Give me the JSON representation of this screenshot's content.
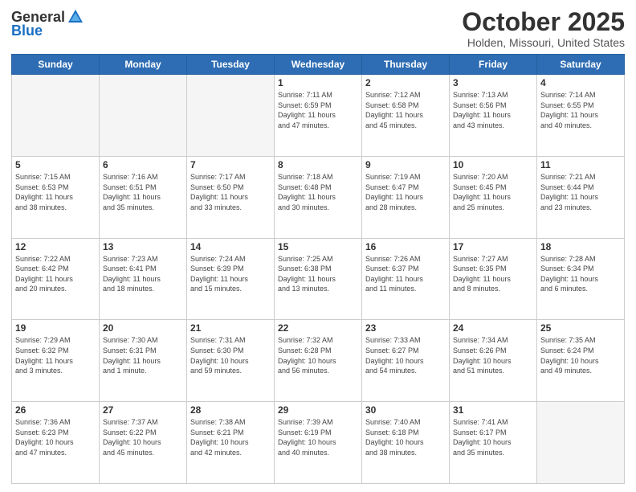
{
  "header": {
    "logo_line1": "General",
    "logo_line2": "Blue",
    "month": "October 2025",
    "location": "Holden, Missouri, United States"
  },
  "days_of_week": [
    "Sunday",
    "Monday",
    "Tuesday",
    "Wednesday",
    "Thursday",
    "Friday",
    "Saturday"
  ],
  "weeks": [
    [
      {
        "day": "",
        "info": ""
      },
      {
        "day": "",
        "info": ""
      },
      {
        "day": "",
        "info": ""
      },
      {
        "day": "1",
        "info": "Sunrise: 7:11 AM\nSunset: 6:59 PM\nDaylight: 11 hours\nand 47 minutes."
      },
      {
        "day": "2",
        "info": "Sunrise: 7:12 AM\nSunset: 6:58 PM\nDaylight: 11 hours\nand 45 minutes."
      },
      {
        "day": "3",
        "info": "Sunrise: 7:13 AM\nSunset: 6:56 PM\nDaylight: 11 hours\nand 43 minutes."
      },
      {
        "day": "4",
        "info": "Sunrise: 7:14 AM\nSunset: 6:55 PM\nDaylight: 11 hours\nand 40 minutes."
      }
    ],
    [
      {
        "day": "5",
        "info": "Sunrise: 7:15 AM\nSunset: 6:53 PM\nDaylight: 11 hours\nand 38 minutes."
      },
      {
        "day": "6",
        "info": "Sunrise: 7:16 AM\nSunset: 6:51 PM\nDaylight: 11 hours\nand 35 minutes."
      },
      {
        "day": "7",
        "info": "Sunrise: 7:17 AM\nSunset: 6:50 PM\nDaylight: 11 hours\nand 33 minutes."
      },
      {
        "day": "8",
        "info": "Sunrise: 7:18 AM\nSunset: 6:48 PM\nDaylight: 11 hours\nand 30 minutes."
      },
      {
        "day": "9",
        "info": "Sunrise: 7:19 AM\nSunset: 6:47 PM\nDaylight: 11 hours\nand 28 minutes."
      },
      {
        "day": "10",
        "info": "Sunrise: 7:20 AM\nSunset: 6:45 PM\nDaylight: 11 hours\nand 25 minutes."
      },
      {
        "day": "11",
        "info": "Sunrise: 7:21 AM\nSunset: 6:44 PM\nDaylight: 11 hours\nand 23 minutes."
      }
    ],
    [
      {
        "day": "12",
        "info": "Sunrise: 7:22 AM\nSunset: 6:42 PM\nDaylight: 11 hours\nand 20 minutes."
      },
      {
        "day": "13",
        "info": "Sunrise: 7:23 AM\nSunset: 6:41 PM\nDaylight: 11 hours\nand 18 minutes."
      },
      {
        "day": "14",
        "info": "Sunrise: 7:24 AM\nSunset: 6:39 PM\nDaylight: 11 hours\nand 15 minutes."
      },
      {
        "day": "15",
        "info": "Sunrise: 7:25 AM\nSunset: 6:38 PM\nDaylight: 11 hours\nand 13 minutes."
      },
      {
        "day": "16",
        "info": "Sunrise: 7:26 AM\nSunset: 6:37 PM\nDaylight: 11 hours\nand 11 minutes."
      },
      {
        "day": "17",
        "info": "Sunrise: 7:27 AM\nSunset: 6:35 PM\nDaylight: 11 hours\nand 8 minutes."
      },
      {
        "day": "18",
        "info": "Sunrise: 7:28 AM\nSunset: 6:34 PM\nDaylight: 11 hours\nand 6 minutes."
      }
    ],
    [
      {
        "day": "19",
        "info": "Sunrise: 7:29 AM\nSunset: 6:32 PM\nDaylight: 11 hours\nand 3 minutes."
      },
      {
        "day": "20",
        "info": "Sunrise: 7:30 AM\nSunset: 6:31 PM\nDaylight: 11 hours\nand 1 minute."
      },
      {
        "day": "21",
        "info": "Sunrise: 7:31 AM\nSunset: 6:30 PM\nDaylight: 10 hours\nand 59 minutes."
      },
      {
        "day": "22",
        "info": "Sunrise: 7:32 AM\nSunset: 6:28 PM\nDaylight: 10 hours\nand 56 minutes."
      },
      {
        "day": "23",
        "info": "Sunrise: 7:33 AM\nSunset: 6:27 PM\nDaylight: 10 hours\nand 54 minutes."
      },
      {
        "day": "24",
        "info": "Sunrise: 7:34 AM\nSunset: 6:26 PM\nDaylight: 10 hours\nand 51 minutes."
      },
      {
        "day": "25",
        "info": "Sunrise: 7:35 AM\nSunset: 6:24 PM\nDaylight: 10 hours\nand 49 minutes."
      }
    ],
    [
      {
        "day": "26",
        "info": "Sunrise: 7:36 AM\nSunset: 6:23 PM\nDaylight: 10 hours\nand 47 minutes."
      },
      {
        "day": "27",
        "info": "Sunrise: 7:37 AM\nSunset: 6:22 PM\nDaylight: 10 hours\nand 45 minutes."
      },
      {
        "day": "28",
        "info": "Sunrise: 7:38 AM\nSunset: 6:21 PM\nDaylight: 10 hours\nand 42 minutes."
      },
      {
        "day": "29",
        "info": "Sunrise: 7:39 AM\nSunset: 6:19 PM\nDaylight: 10 hours\nand 40 minutes."
      },
      {
        "day": "30",
        "info": "Sunrise: 7:40 AM\nSunset: 6:18 PM\nDaylight: 10 hours\nand 38 minutes."
      },
      {
        "day": "31",
        "info": "Sunrise: 7:41 AM\nSunset: 6:17 PM\nDaylight: 10 hours\nand 35 minutes."
      },
      {
        "day": "",
        "info": ""
      }
    ]
  ]
}
